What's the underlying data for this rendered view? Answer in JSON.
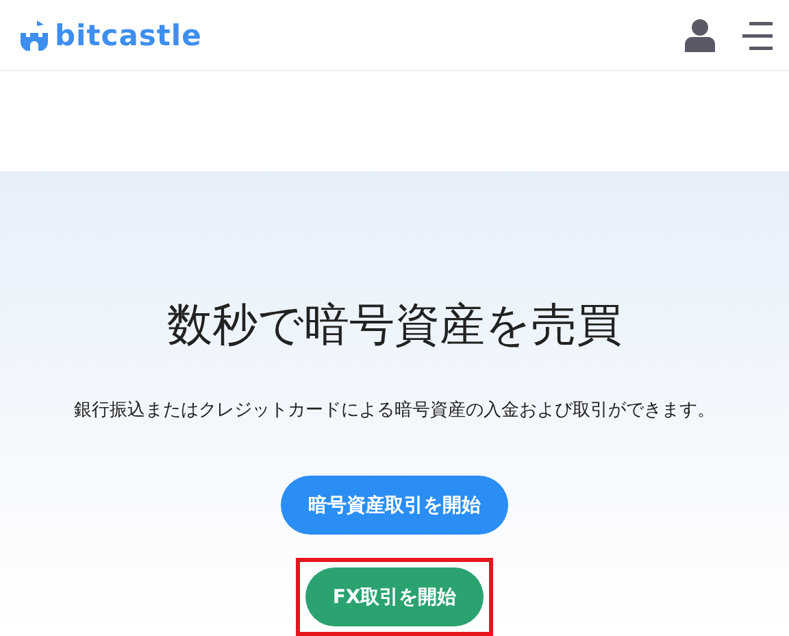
{
  "header": {
    "logo": "bitcastle"
  },
  "hero": {
    "title": "数秒で暗号資産を売買",
    "subtitle": "銀行振込またはクレジットカードによる暗号資産の入金および取引ができます。",
    "buttons": [
      {
        "label": "暗号資産取引を開始",
        "kind": "crypto",
        "highlighted": false
      },
      {
        "label": "FX取引を開始",
        "kind": "fx",
        "highlighted": true
      }
    ]
  }
}
